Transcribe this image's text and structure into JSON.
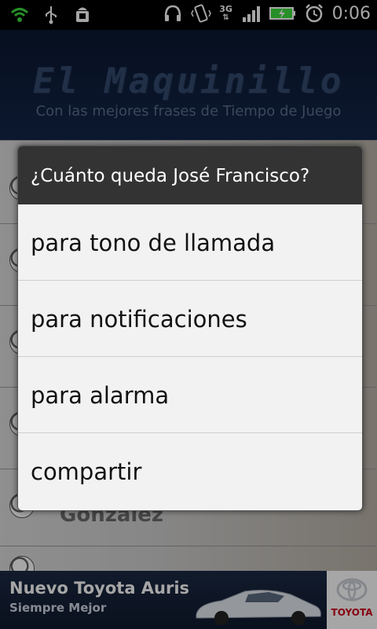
{
  "status_bar": {
    "network": "3G",
    "time": "0:06",
    "icons": [
      "wifi-icon",
      "usb-icon",
      "android-debug-icon",
      "headphones-icon",
      "vibrate-icon",
      "signal-icon",
      "battery-charging-icon",
      "alarm-clock-icon"
    ]
  },
  "header": {
    "title": "El Maquinillo",
    "subtitle": "Con las mejores frases de Tiempo de Juego"
  },
  "background_list": {
    "visible_name": "Gonzalez"
  },
  "dialog": {
    "title": "¿Cuánto queda José Francisco?",
    "items": [
      {
        "label": "para tono de llamada"
      },
      {
        "label": "para notificaciones"
      },
      {
        "label": "para alarma"
      },
      {
        "label": "compartir"
      }
    ]
  },
  "ad": {
    "title": "Nuevo Toyota Auris",
    "subtitle": "Siempre Mejor",
    "brand": "TOYOTA",
    "brand_color": "#d0021b"
  }
}
